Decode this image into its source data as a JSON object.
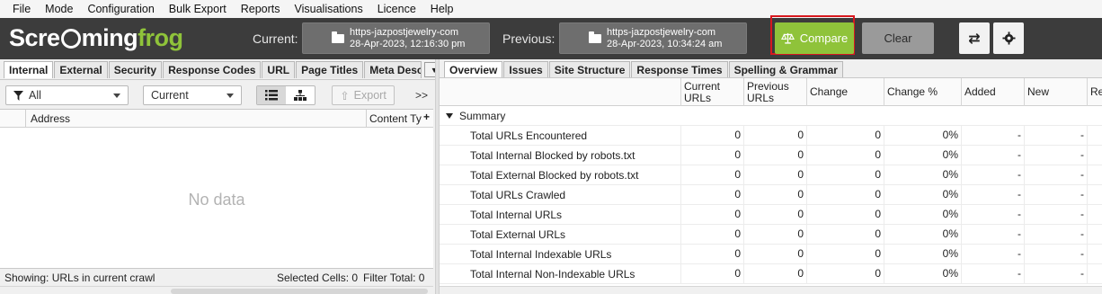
{
  "menu": [
    "File",
    "Mode",
    "Configuration",
    "Bulk Export",
    "Reports",
    "Visualisations",
    "Licence",
    "Help"
  ],
  "logo": {
    "part1": "Scre",
    "part2": "ming",
    "part3": "frog"
  },
  "header": {
    "current_label": "Current:",
    "previous_label": "Previous:",
    "current_crawl": {
      "url": "https-jazpostjewelry-com",
      "date": "28-Apr-2023, 12:16:30 pm"
    },
    "previous_crawl": {
      "url": "https-jazpostjewelry-com",
      "date": "28-Apr-2023, 10:34:24 am"
    },
    "compare_label": "Compare",
    "clear_label": "Clear",
    "accent_color": "#8fc33a",
    "highlight_color": "#d8181f"
  },
  "left_tabs": [
    "Internal",
    "External",
    "Security",
    "Response Codes",
    "URL",
    "Page Titles",
    "Meta Descri"
  ],
  "left_toolbar": {
    "filter_value": "All",
    "mode_value": "Current",
    "export_label": "Export",
    "more_label": ">>"
  },
  "left_grid": {
    "col_address": "Address",
    "col_content_type": "Content Ty",
    "add_col": "+",
    "empty_text": "No data"
  },
  "left_status": {
    "showing": "Showing: URLs in current crawl",
    "selected": "Selected Cells:  0",
    "filter_total": "Filter Total:  0"
  },
  "right_tabs": [
    "Overview",
    "Issues",
    "Site Structure",
    "Response Times",
    "Spelling & Grammar"
  ],
  "right_headers": {
    "current": "Current URLs",
    "previous": "Previous URLs",
    "change": "Change",
    "change_pct": "Change %",
    "added": "Added",
    "new": "New",
    "removed": "Re"
  },
  "summary_label": "Summary",
  "rows": [
    {
      "name": "Total URLs Encountered",
      "current": "0",
      "previous": "0",
      "change": "0",
      "pct": "0%",
      "added": "-",
      "new": "-"
    },
    {
      "name": "Total Internal Blocked by robots.txt",
      "current": "0",
      "previous": "0",
      "change": "0",
      "pct": "0%",
      "added": "-",
      "new": "-"
    },
    {
      "name": "Total External Blocked by robots.txt",
      "current": "0",
      "previous": "0",
      "change": "0",
      "pct": "0%",
      "added": "-",
      "new": "-"
    },
    {
      "name": "Total URLs Crawled",
      "current": "0",
      "previous": "0",
      "change": "0",
      "pct": "0%",
      "added": "-",
      "new": "-"
    },
    {
      "name": "Total Internal URLs",
      "current": "0",
      "previous": "0",
      "change": "0",
      "pct": "0%",
      "added": "-",
      "new": "-"
    },
    {
      "name": "Total External URLs",
      "current": "0",
      "previous": "0",
      "change": "0",
      "pct": "0%",
      "added": "-",
      "new": "-"
    },
    {
      "name": "Total Internal Indexable URLs",
      "current": "0",
      "previous": "0",
      "change": "0",
      "pct": "0%",
      "added": "-",
      "new": "-"
    },
    {
      "name": "Total Internal Non-Indexable URLs",
      "current": "0",
      "previous": "0",
      "change": "0",
      "pct": "0%",
      "added": "-",
      "new": "-"
    }
  ],
  "icons": {
    "filter": "filter-icon",
    "list": "list-view-icon",
    "tree": "tree-view-icon",
    "export": "export-icon",
    "swap": "swap-icon",
    "settings": "gear-icon",
    "compare": "scale-icon",
    "folder": "folder-icon"
  }
}
